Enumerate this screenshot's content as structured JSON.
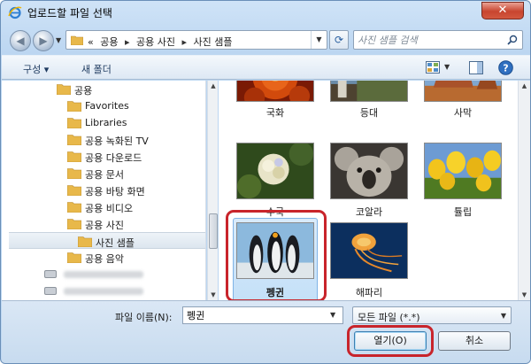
{
  "window": {
    "title": "업로드할 파일 선택",
    "close_label": "✕"
  },
  "address": {
    "prefix": "«",
    "crumbs": [
      "공용",
      "공용 사진",
      "사진 샘플"
    ],
    "separator": "▸"
  },
  "search": {
    "placeholder": "사진 샘플 검색"
  },
  "toolbar": {
    "organize_label": "구성 ▾",
    "new_folder_label": "새 폴더"
  },
  "nav_tree": {
    "items": [
      {
        "label": "공용",
        "indent": 1,
        "selected": false
      },
      {
        "label": "Favorites",
        "indent": 2,
        "selected": false
      },
      {
        "label": "Libraries",
        "indent": 2,
        "selected": false
      },
      {
        "label": "공용 녹화된 TV",
        "indent": 2,
        "selected": false
      },
      {
        "label": "공용 다운로드",
        "indent": 2,
        "selected": false
      },
      {
        "label": "공용 문서",
        "indent": 2,
        "selected": false
      },
      {
        "label": "공용 바탕 화면",
        "indent": 2,
        "selected": false
      },
      {
        "label": "공용 비디오",
        "indent": 2,
        "selected": false
      },
      {
        "label": "공용 사진",
        "indent": 2,
        "selected": false
      },
      {
        "label": "사진 샘플",
        "indent": 3,
        "selected": true
      },
      {
        "label": "공용 음악",
        "indent": 2,
        "selected": false
      }
    ]
  },
  "files": [
    {
      "name": "국화",
      "selected": false
    },
    {
      "name": "등대",
      "selected": false
    },
    {
      "name": "사막",
      "selected": false
    },
    {
      "name": "수국",
      "selected": false
    },
    {
      "name": "코알라",
      "selected": false
    },
    {
      "name": "튤립",
      "selected": false
    },
    {
      "name": "펭귄",
      "selected": true
    },
    {
      "name": "해파리",
      "selected": false
    }
  ],
  "bottom": {
    "filename_label": "파일 이름(N):",
    "filename_value": "펭귄",
    "filetype_value": "모든 파일 (*.*)",
    "open_label": "열기(O)",
    "cancel_label": "취소"
  },
  "colors": {
    "highlight_ring": "#c8242b",
    "selection_fill": "#cce4f9",
    "folder": "#e8b84a"
  }
}
